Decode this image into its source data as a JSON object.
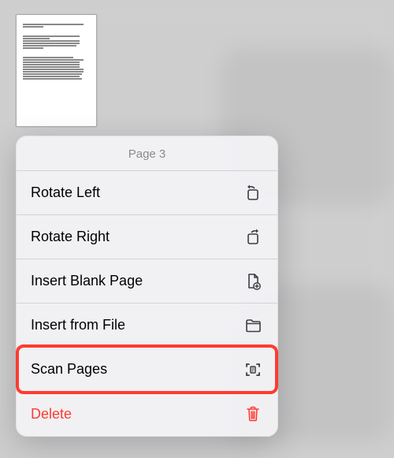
{
  "menu": {
    "title": "Page 3",
    "items": [
      {
        "id": "rotate-left",
        "label": "Rotate Left",
        "icon": "rotate-left-icon",
        "colorText": "#000",
        "colorIcon": "#3c3c43",
        "highlight": false
      },
      {
        "id": "rotate-right",
        "label": "Rotate Right",
        "icon": "rotate-right-icon",
        "colorText": "#000",
        "colorIcon": "#3c3c43",
        "highlight": false
      },
      {
        "id": "insert-blank",
        "label": "Insert Blank Page",
        "icon": "insert-blank-icon",
        "colorText": "#000",
        "colorIcon": "#3c3c43",
        "highlight": false
      },
      {
        "id": "insert-file",
        "label": "Insert from File",
        "icon": "folder-icon",
        "colorText": "#000",
        "colorIcon": "#3c3c43",
        "highlight": false
      },
      {
        "id": "scan-pages",
        "label": "Scan Pages",
        "icon": "scan-icon",
        "colorText": "#000",
        "colorIcon": "#3c3c43",
        "highlight": true
      },
      {
        "id": "delete",
        "label": "Delete",
        "icon": "trash-icon",
        "colorText": "#ff3b30",
        "colorIcon": "#ff3b30",
        "highlight": false
      }
    ]
  }
}
